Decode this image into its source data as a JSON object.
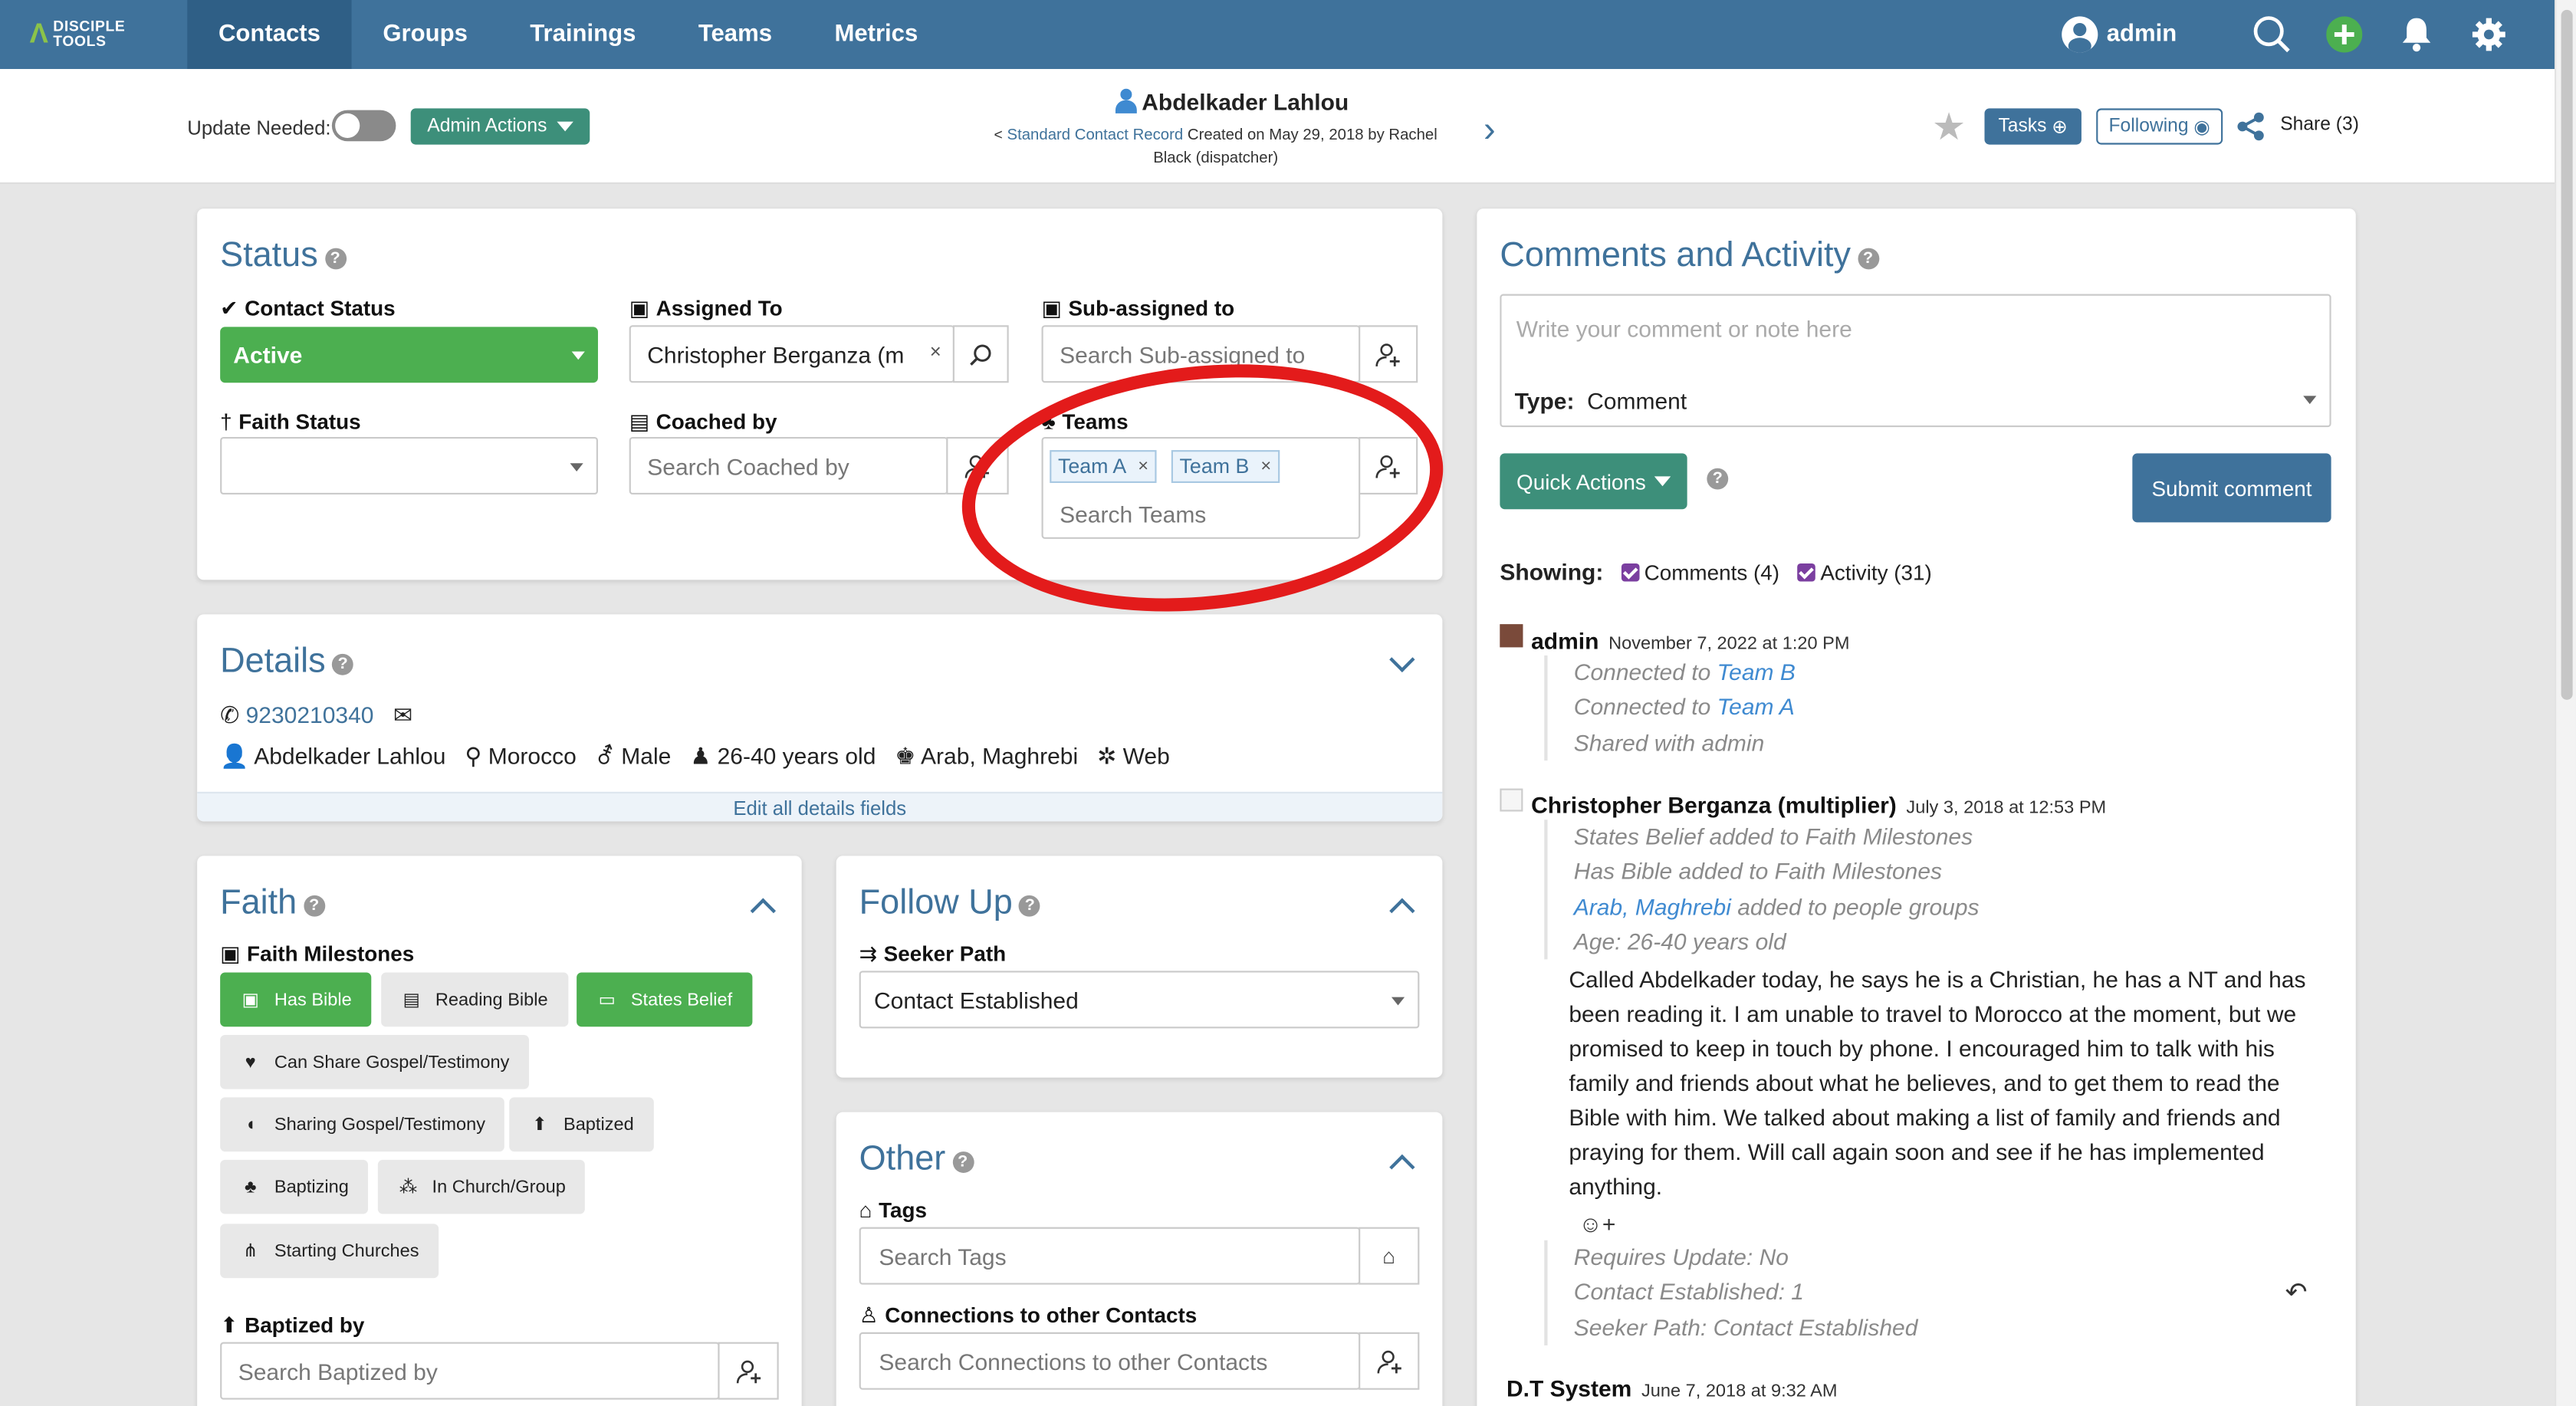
{
  "brand": {
    "line1": "DISCIPLE",
    "line2": "TOOLS"
  },
  "nav": {
    "items": [
      "Contacts",
      "Groups",
      "Trainings",
      "Teams",
      "Metrics"
    ],
    "active": "Contacts"
  },
  "user": {
    "name": "admin"
  },
  "subbar": {
    "update_needed_label": "Update Needed:",
    "admin_actions_label": "Admin Actions",
    "record_name": "Abdelkader Lahlou",
    "record_link": "Standard Contact Record",
    "created_text": "Created on May 29, 2018 by Rachel Black (dispatcher)",
    "tasks_label": "Tasks",
    "following_label": "Following",
    "share_label": "Share (3)"
  },
  "status": {
    "title": "Status",
    "contact_status_label": "Contact Status",
    "contact_status_value": "Active",
    "assigned_to_label": "Assigned To",
    "assigned_to_value": "Christopher Berganza (m",
    "subassigned_label": "Sub-assigned to",
    "subassigned_placeholder": "Search Sub-assigned to",
    "faith_status_label": "Faith Status",
    "faith_status_value": "",
    "coached_by_label": "Coached by",
    "coached_by_placeholder": "Search Coached by",
    "teams_label": "Teams",
    "teams": [
      "Team A",
      "Team B"
    ],
    "teams_placeholder": "Search Teams"
  },
  "details": {
    "title": "Details",
    "phone": "9230210340",
    "name": "Abdelkader Lahlou",
    "location": "Morocco",
    "gender": "Male",
    "age": "26-40 years old",
    "people_group": "Arab, Maghrebi",
    "source": "Web",
    "edit_label": "Edit all details fields"
  },
  "faith": {
    "title": "Faith",
    "milestones_label": "Faith Milestones",
    "milestones": [
      {
        "label": "Has Bible",
        "on": true
      },
      {
        "label": "Reading Bible",
        "on": false
      },
      {
        "label": "States Belief",
        "on": true
      },
      {
        "label": "Can Share Gospel/Testimony",
        "on": false
      },
      {
        "label": "Sharing Gospel/Testimony",
        "on": false
      },
      {
        "label": "Baptized",
        "on": false
      },
      {
        "label": "Baptizing",
        "on": false
      },
      {
        "label": "In Church/Group",
        "on": false
      },
      {
        "label": "Starting Churches",
        "on": false
      }
    ],
    "baptized_by_label": "Baptized by",
    "baptized_by_placeholder": "Search Baptized by"
  },
  "follow_up": {
    "title": "Follow Up",
    "seeker_path_label": "Seeker Path",
    "seeker_path_value": "Contact Established"
  },
  "other": {
    "title": "Other",
    "tags_label": "Tags",
    "tags_placeholder": "Search Tags",
    "connections_label": "Connections to other Contacts",
    "connections_placeholder": "Search Connections to other Contacts"
  },
  "comments": {
    "title": "Comments and Activity",
    "placeholder": "Write your comment or note here",
    "type_label": "Type:",
    "type_value": "Comment",
    "quick_actions_label": "Quick Actions",
    "submit_label": "Submit comment",
    "showing_label": "Showing:",
    "filter_comments": "Comments (4)",
    "filter_activity": "Activity (31)",
    "entries": [
      {
        "author": "admin",
        "when": "November 7, 2022 at 1:20 PM",
        "activity": [
          "Connected to ",
          "Connected to ",
          "Shared with admin"
        ],
        "links": [
          "Team B",
          "Team A"
        ]
      },
      {
        "author": "Christopher Berganza (multiplier)",
        "when": "July 3, 2018 at 12:53 PM",
        "activity": [
          "States Belief added to Faith Milestones",
          "Has Bible added to Faith Milestones",
          " added to people groups",
          "Age: 26-40 years old"
        ],
        "link": "Arab, Maghrebi",
        "comment": "Called Abdelkader today, he says he is a Christian, he has a NT and has been reading it. I am unable to travel to Morocco at the moment, but we promised to keep in touch by phone. I encouraged him to talk with his family and friends about what he believes, and to get them to read the Bible with him. We talked about making a list of family and friends and praying for them. Will call again soon and see if he has implemented anything.",
        "activity2": [
          "Requires Update: No",
          "Contact Established: 1",
          "Seeker Path: Contact Established"
        ]
      },
      {
        "author": "D.T System",
        "when": "June 7, 2018 at 9:32 AM"
      }
    ]
  },
  "colors": {
    "primary": "#3f729b",
    "success": "#4caf50",
    "teal": "#3d8f7a",
    "highlight_ring": "#e31b1b"
  }
}
